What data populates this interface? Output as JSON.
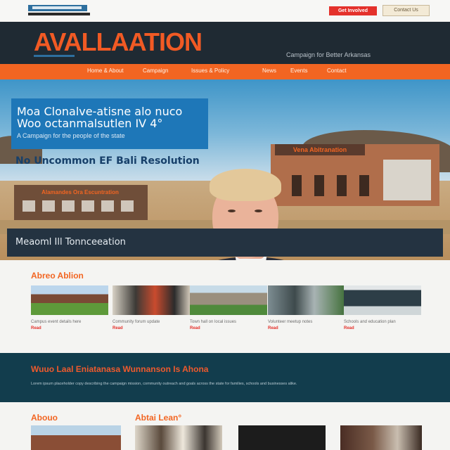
{
  "topbar": {
    "cta_primary": "Get Involved",
    "cta_secondary": "Contact Us"
  },
  "header": {
    "brand": "AVALLAATION",
    "tagline": "Campaign for Better Arkansas"
  },
  "nav": {
    "items": [
      "Home & About",
      "Campaign",
      "Issues & Policy",
      "News",
      "Events",
      "Contact"
    ]
  },
  "hero": {
    "headline_line1": "Moa Clonalve-atisne alo nuco",
    "headline_line2": "Woo octanmalsutlen IV 4°",
    "headline_sub": "A Campaign for the people of the state",
    "strapline": "No Uncommon EF Bali Resolution",
    "building_label": "Vena Abitranation",
    "left_building_label": "Alamandes Ora Escuntration",
    "caption": "Meaoml Ill Tonnceeation"
  },
  "section1": {
    "title": "Abreo Ablion",
    "cards": [
      {
        "meta": "Campus event details here",
        "tag": "Read"
      },
      {
        "meta": "Community forum update",
        "tag": "Read"
      },
      {
        "meta": "Town hall on local issues",
        "tag": "Read"
      },
      {
        "meta": "Volunteer meetup notes",
        "tag": "Read"
      },
      {
        "meta": "Schools and education plan",
        "tag": "Read"
      }
    ]
  },
  "band": {
    "title": "Wuuo Laal Eniatanasa Wunnanson Is Ahona",
    "text": "Lorem ipsum placeholder copy describing the campaign mission, community outreach and goals across the state for families, schools and businesses alike."
  },
  "section2": {
    "title_left": "Abouo",
    "title_mid": "Abtai Lean°"
  }
}
